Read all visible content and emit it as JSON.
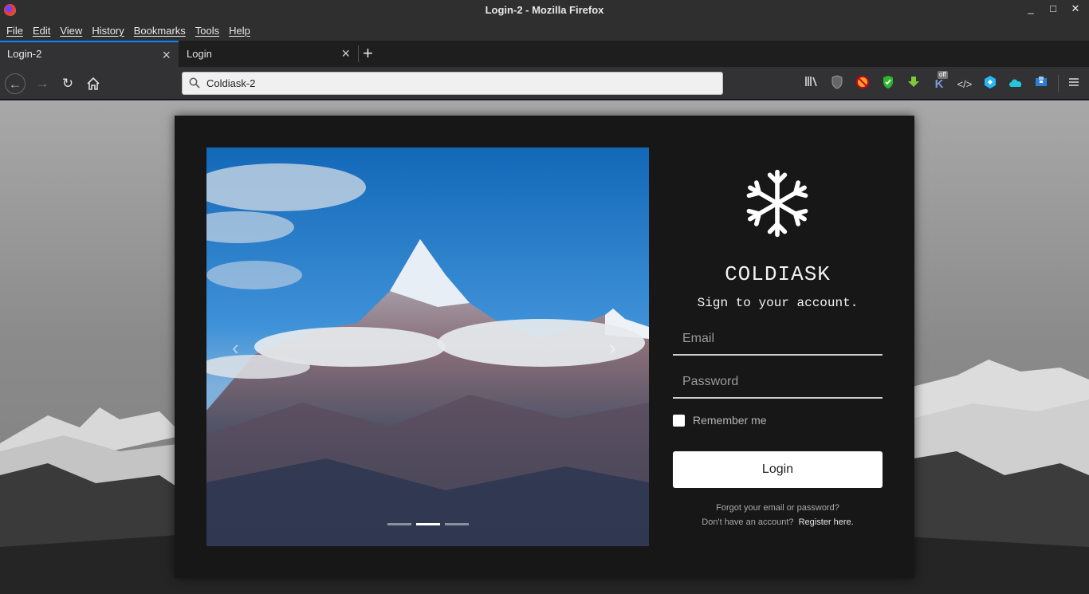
{
  "window": {
    "title": "Login-2 - Mozilla Firefox",
    "controls": [
      "_",
      "□",
      "✕"
    ]
  },
  "menu": [
    "File",
    "Edit",
    "View",
    "History",
    "Bookmarks",
    "Tools",
    "Help"
  ],
  "tabs": [
    {
      "label": "Login-2",
      "active": true
    },
    {
      "label": "Login",
      "active": false
    }
  ],
  "toolbar": {
    "url": "Coldiask-2",
    "extension_badge": "off",
    "icons": [
      "library-icon",
      "shield-icon",
      "blocker-icon",
      "green-shield-icon",
      "download-icon",
      "k-extension-icon",
      "devtools-icon",
      "cube-icon",
      "cloud-icon",
      "box-icon",
      "menu-icon"
    ]
  },
  "carousel": {
    "prev": "‹",
    "next": "›",
    "slides": 3,
    "active_slide": 2
  },
  "login": {
    "brand": "COLDIASK",
    "subtitle": "Sign to your account.",
    "email_placeholder": "Email",
    "password_placeholder": "Password",
    "remember_label": "Remember me",
    "button_label": "Login",
    "forgot_text": "Forgot your email or password?",
    "no_account_text": "Don't have an account?",
    "register_link": "Register here."
  }
}
